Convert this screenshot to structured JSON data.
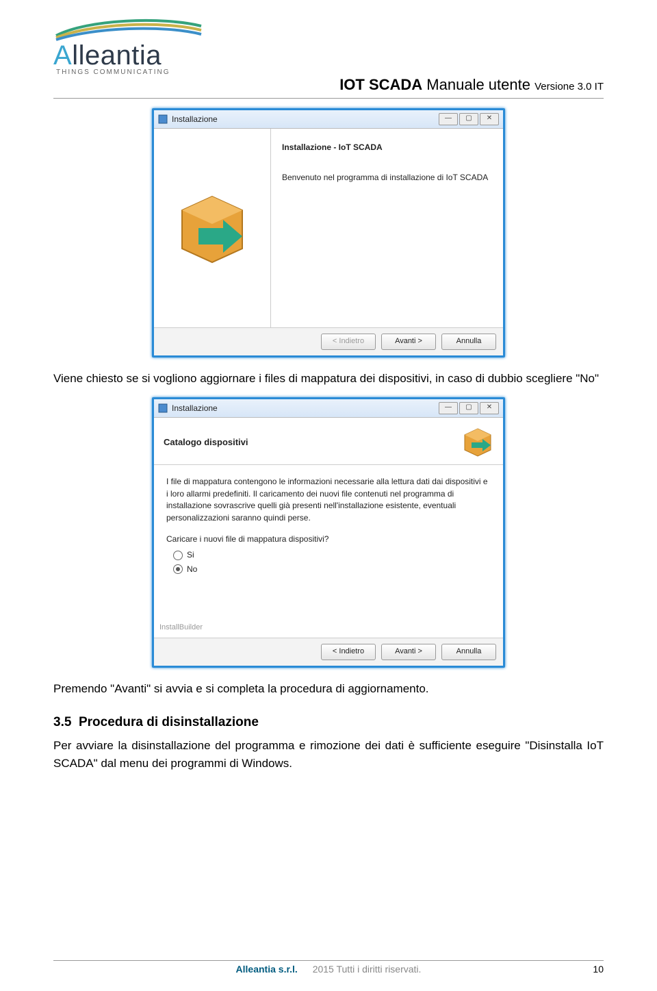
{
  "logo": {
    "name": "Alleantia",
    "tagline": "THINGS COMMUNICATING"
  },
  "header": {
    "product_bold": "IOT SCADA",
    "product_rest": " Manuale utente ",
    "version": "Versione 3.0 IT"
  },
  "installer1": {
    "window_title": "Installazione",
    "heading": "Installazione - IoT SCADA",
    "welcome": "Benvenuto nel programma di installazione di IoT SCADA",
    "btn_back": "< Indietro",
    "btn_next": "Avanti >",
    "btn_cancel": "Annulla"
  },
  "para1": "Viene chiesto se si vogliono aggiornare i files di mappatura dei dispositivi, in caso di dubbio scegliere \"No\"",
  "installer2": {
    "window_title": "Installazione",
    "subtitle": "Catalogo dispositivi",
    "body_text": "I file di mappatura contengono le informazioni necessarie alla lettura dati dai dispositivi e i loro allarmi predefiniti. Il caricamento dei nuovi file contenuti nel programma di installazione sovrascrive quelli già presenti nell'installazione esistente, eventuali personalizzazioni saranno quindi perse.",
    "question": "Caricare i nuovi file di mappatura dispositivi?",
    "opt_yes": "Si",
    "opt_no": "No",
    "builder": "InstallBuilder",
    "btn_back": "< Indietro",
    "btn_next": "Avanti >",
    "btn_cancel": "Annulla"
  },
  "para2": "Premendo \"Avanti\" si avvia e si completa la procedura di aggiornamento.",
  "section": {
    "num": "3.5",
    "title": "Procedura di disinstallazione"
  },
  "para3": "Per avviare la disinstallazione del programma e rimozione dei dati è sufficiente eseguire \"Disinstalla IoT SCADA\" dal menu dei programmi di Windows.",
  "footer": {
    "company": "Alleantia s.r.l.",
    "rights": "2015 Tutti i diritti riservati.",
    "page": "10"
  }
}
